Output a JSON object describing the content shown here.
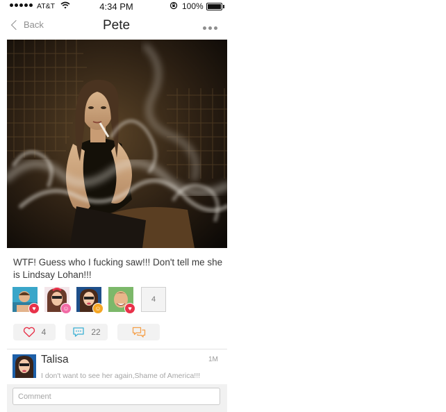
{
  "status_bar": {
    "carrier": "AT&T",
    "time": "4:34 PM",
    "battery": "100%"
  },
  "nav": {
    "back_label": "Back",
    "title": "Pete"
  },
  "post": {
    "text": "WTF!  Guess who I fucking saw!!! Don't tell me she is Lindsay Lohan!!!",
    "reactions": [
      {
        "reaction": "love",
        "color": "#e8324a"
      },
      {
        "reaction": "laugh",
        "color": "#f26ba6"
      },
      {
        "reaction": "smile",
        "color": "#f5a623"
      },
      {
        "reaction": "love",
        "color": "#e8324a"
      }
    ],
    "more_reactions_count": "4"
  },
  "actions": {
    "likes": "4",
    "comments": "22",
    "accent_color": "#f5a04a",
    "like_color": "#e8324a",
    "comment_color": "#3ab0d4"
  },
  "comment": {
    "author": "Talisa",
    "time": "1M",
    "body": "I don't want to see her again,Shame of America!!!"
  },
  "input": {
    "placeholder": "Comment"
  }
}
